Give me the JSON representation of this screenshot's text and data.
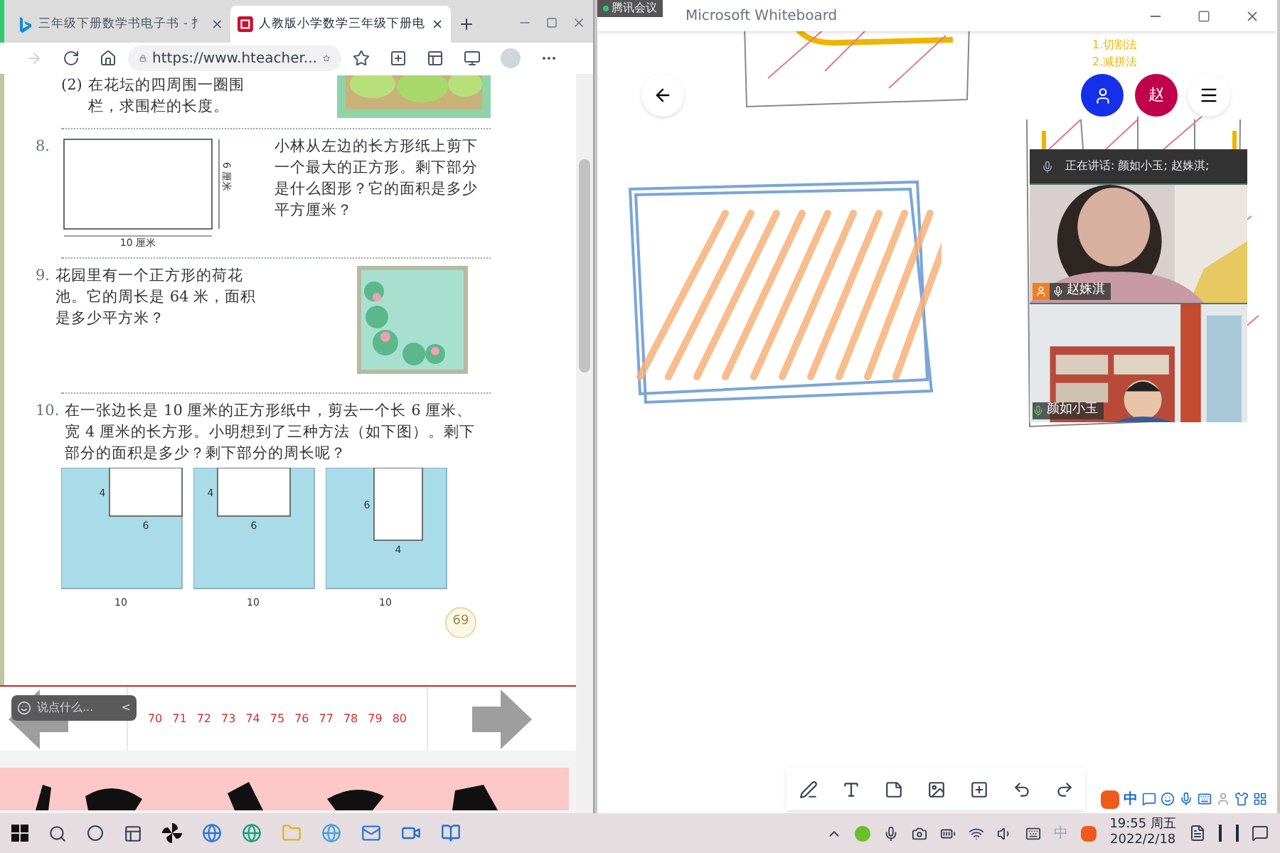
{
  "browser": {
    "tabs": [
      {
        "title": "三年级下册数学书电子书 - 扌",
        "selected": false
      },
      {
        "title": "人教版小学数学三年级下册电",
        "selected": true
      }
    ],
    "address": "https://www.hteacher...",
    "page": {
      "problem_7": {
        "number": "(2)",
        "text": "在花坛的四周围一圈围栏，求围栏的长度。"
      },
      "problem_8": {
        "number": "8.",
        "text": "小林从左边的长方形纸上剪下一个最大的正方形。剩下部分是什么图形？它的面积是多少平方厘米？",
        "width_label": "10 厘米",
        "height_label": "6 厘米"
      },
      "problem_9": {
        "number": "9.",
        "text": "花园里有一个正方形的荷花池。它的周长是 64 米，面积是多少平方米？"
      },
      "problem_10": {
        "number": "10.",
        "text": "在一张边长是 10 厘米的正方形纸中，剪去一个长 6 厘米、宽 4 厘米的长方形。小明想到了三种方法（如下图）。剩下部分的面积是多少？剩下部分的周长呢？",
        "figures": [
          {
            "kind": "corner",
            "side_label": "4",
            "cut_label": "6",
            "base_label": "10"
          },
          {
            "kind": "middle",
            "side_label": "4",
            "cut_label": "6",
            "base_label": "10"
          },
          {
            "kind": "tall",
            "side_label": "6",
            "cut_label": "4",
            "base_label": "10"
          }
        ]
      },
      "page_number": "69"
    },
    "pager": {
      "comment_placeholder": "说点什么...",
      "collapse": "<",
      "pages": [
        "70",
        "71",
        "72",
        "73",
        "74",
        "75",
        "76",
        "77",
        "78",
        "79",
        "80"
      ]
    }
  },
  "whiteboard": {
    "title": "Microsoft Whiteboard",
    "meeting_badge": "腾讯会议",
    "notes": [
      "1.切割法",
      "2.减拼法"
    ],
    "avatar": "赵",
    "speaking": "正在讲话: 颜如小玉; 赵姝淇;",
    "participants": [
      {
        "name": "赵姝淇",
        "host": true
      },
      {
        "name": "颜如小玉",
        "host": false
      }
    ]
  },
  "ime": {
    "mode": "中"
  },
  "taskbar": {
    "ime": "中",
    "time": "19:55 周五",
    "date": "2022/2/18"
  }
}
